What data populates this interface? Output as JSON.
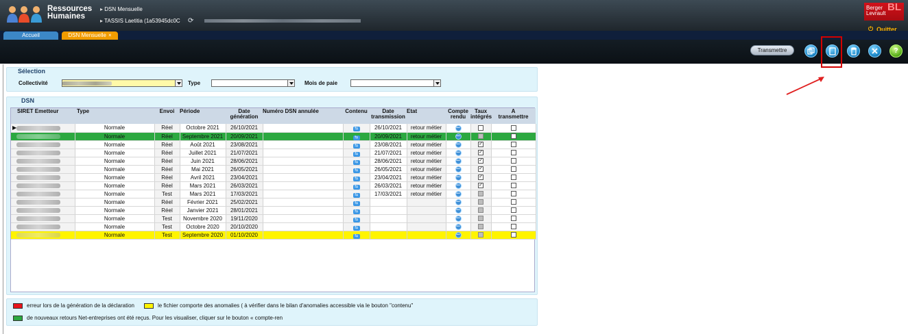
{
  "header": {
    "app_title_line1": "Ressources",
    "app_title_line2": "Humaines",
    "breadcrumb_1": "DSN Mensuelle",
    "breadcrumb_2": "TASSIS Laetitia (1a53945dc0C",
    "logo_text_line1": "Berger",
    "logo_text_line2": "Levrault",
    "logo_mark": "BL",
    "quit_label": "Quitter"
  },
  "tabs": [
    {
      "label": "Accueil"
    },
    {
      "label": "DSN Mensuelle",
      "close": "×"
    }
  ],
  "toolbar": {
    "transmit_label": "Transmettre",
    "icons": [
      "copy-icon",
      "document-icon",
      "delete-icon",
      "tools-icon",
      "help-icon"
    ]
  },
  "selection": {
    "title": "Sélection",
    "collectivite_label": "Collectivité",
    "type_label": "Type",
    "mois_label": "Mois de paie",
    "type_value": "",
    "mois_value": ""
  },
  "dsn": {
    "title": "DSN",
    "headers": {
      "siret": "SIRET Emetteur",
      "type": "Type",
      "envoi": "Envoi",
      "periode": "Période",
      "date_gen_1": "Date",
      "date_gen_2": "génération",
      "numero": "Numéro DSN annulée",
      "contenu": "Contenu",
      "date_tr_1": "Date",
      "date_tr_2": "transmission",
      "etat": "Etat",
      "compte_1": "Compte",
      "compte_2": "rendu",
      "taux_1": "Taux",
      "taux_2": "intégrés",
      "a_trans_1": "A",
      "a_trans_2": "transmettre"
    },
    "rows": [
      {
        "type": "Normale",
        "envoi": "Réel",
        "periode": "Octobre 2021",
        "date_gen": "26/10/2021",
        "date_tr": "26/10/2021",
        "etat": "retour métier",
        "taux": "unchecked",
        "a_transmettre": "unchecked",
        "status": "normal",
        "current": true
      },
      {
        "type": "Normale",
        "envoi": "Réel",
        "periode": "Septembre 2021",
        "date_gen": "20/09/2021",
        "date_tr": "20/09/2021",
        "etat": "retour métier",
        "taux": "disabled",
        "a_transmettre": "unchecked",
        "status": "green"
      },
      {
        "type": "Normale",
        "envoi": "Réel",
        "periode": "Août 2021",
        "date_gen": "23/08/2021",
        "date_tr": "23/08/2021",
        "etat": "retour métier",
        "taux": "checked",
        "a_transmettre": "unchecked",
        "status": "normal"
      },
      {
        "type": "Normale",
        "envoi": "Réel",
        "periode": "Juillet 2021",
        "date_gen": "21/07/2021",
        "date_tr": "21/07/2021",
        "etat": "retour métier",
        "taux": "checked",
        "a_transmettre": "unchecked",
        "status": "normal"
      },
      {
        "type": "Normale",
        "envoi": "Réel",
        "periode": "Juin 2021",
        "date_gen": "28/06/2021",
        "date_tr": "28/06/2021",
        "etat": "retour métier",
        "taux": "checked",
        "a_transmettre": "unchecked",
        "status": "normal"
      },
      {
        "type": "Normale",
        "envoi": "Réel",
        "periode": "Mai 2021",
        "date_gen": "26/05/2021",
        "date_tr": "26/05/2021",
        "etat": "retour métier",
        "taux": "checked",
        "a_transmettre": "unchecked",
        "status": "normal"
      },
      {
        "type": "Normale",
        "envoi": "Réel",
        "periode": "Avril 2021",
        "date_gen": "23/04/2021",
        "date_tr": "23/04/2021",
        "etat": "retour métier",
        "taux": "checked",
        "a_transmettre": "unchecked",
        "status": "normal"
      },
      {
        "type": "Normale",
        "envoi": "Réel",
        "periode": "Mars 2021",
        "date_gen": "26/03/2021",
        "date_tr": "26/03/2021",
        "etat": "retour métier",
        "taux": "checked",
        "a_transmettre": "unchecked",
        "status": "normal"
      },
      {
        "type": "Normale",
        "envoi": "Test",
        "periode": "Mars 2021",
        "date_gen": "17/03/2021",
        "date_tr": "17/03/2021",
        "etat": "retour métier",
        "taux": "disabled",
        "a_transmettre": "unchecked",
        "status": "normal"
      },
      {
        "type": "Normale",
        "envoi": "Réel",
        "periode": "Février 2021",
        "date_gen": "25/02/2021",
        "date_tr": "",
        "etat": "",
        "taux": "disabled",
        "a_transmettre": "unchecked",
        "status": "normal"
      },
      {
        "type": "Normale",
        "envoi": "Réel",
        "periode": "Janvier 2021",
        "date_gen": "28/01/2021",
        "date_tr": "",
        "etat": "",
        "taux": "disabled",
        "a_transmettre": "unchecked",
        "status": "normal"
      },
      {
        "type": "Normale",
        "envoi": "Test",
        "periode": "Novembre 2020",
        "date_gen": "19/11/2020",
        "date_tr": "",
        "etat": "",
        "taux": "disabled",
        "a_transmettre": "unchecked",
        "status": "normal"
      },
      {
        "type": "Normale",
        "envoi": "Test",
        "periode": "Octobre 2020",
        "date_gen": "20/10/2020",
        "date_tr": "",
        "etat": "",
        "taux": "disabled",
        "a_transmettre": "unchecked",
        "status": "normal"
      },
      {
        "type": "Normale",
        "envoi": "Test",
        "periode": "Septembre 2020",
        "date_gen": "01/10/2020",
        "date_tr": "",
        "etat": "",
        "taux": "disabled",
        "a_transmettre": "unchecked",
        "status": "yellow"
      }
    ]
  },
  "legend": {
    "red_text": "erreur lors de la génération de la déclaration",
    "yellow_text": "le fichier comporte des anomalies ( à vérifier dans le bilan d'anomalies accessible via le bouton \"contenu\"",
    "green_text": "de nouveaux retours Net-entreprises ont été reçus. Pour les visualiser, cliquer sur le bouton « compte-ren",
    "colors": {
      "red": "#e8151c",
      "yellow": "#fff400",
      "green": "#2ca840"
    }
  }
}
